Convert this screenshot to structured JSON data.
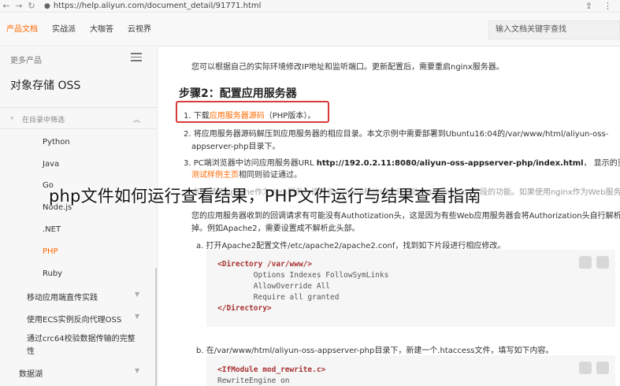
{
  "browser": {
    "url": "https://help.aliyun.com/document_detail/91771.html",
    "back_icon": "←",
    "forward_icon": "→",
    "reload_icon": "↻",
    "lock_icon": "🔒",
    "share_icon": "⇪",
    "menu_icon": "⋮"
  },
  "topnav": {
    "tabs": [
      "产品文档",
      "实战派",
      "大咖答",
      "云视界"
    ],
    "search_placeholder": "输入文档关键字查找"
  },
  "sidebar": {
    "more_products": "更多产品",
    "product_title": "对象存储 OSS",
    "filter_placeholder": "在目录中筛选",
    "filter_icon": "⌕",
    "collapse_icon": "︽",
    "sdk_items": [
      "Python",
      "Java",
      "Go",
      "Node.js",
      ".NET",
      "PHP",
      "Ruby"
    ],
    "active_item": "PHP",
    "groups": [
      "移动应用端直传实践",
      "使用ECS实例反向代理OSS",
      "通过crc64校验数据传输的完整性",
      "数据湖"
    ]
  },
  "content": {
    "intro": "您可以根据自己的实际环境修改IP地址和监听端口。更新配置后，需要重启nginx服务器。",
    "step_heading": "步骤2：配置应用服务器",
    "step1_prefix": "1. 下载",
    "step1_link": "应用服务器源码",
    "step1_suffix": "（PHP版本）。",
    "step2_line1": "2. 将应用服务器源码解压到应用服务器的相应目录。本文示例中需要部署到Ubuntu16:04的/var/www/html/aliyun-oss-",
    "step2_line2": "appserver-php目录下。",
    "step3_prefix": "3. PC端浏览器中访问应用服务器URL ",
    "step3_url": "http://192.0.2.11:8080/aliyun-oss-appserver-php/index.html",
    "step3_suffix": "，  显示的页面内容与",
    "step3_link": "测试样例主页",
    "step3_tail": "相同则验证通过。",
    "step4_line1": "4. 如果使用Apache作为Web服务，请开启Apache模块URL头部的Authorization字段的功能。如果使用nginx作为Web服务",
    "step4_line2": "您的应用服务器收到的回调请求有可能没有Authotization头，这是因为有些Web应用服务器会将Authorization头自行解析",
    "step4_line3": "掉。例如Apache2，需要设置成不解析此头部。",
    "sub_a": "a. 打开Apache2配置文件/etc/apache2/apache2.conf，找到如下片段进行相应修改。",
    "code_a": [
      "<Directory /var/www/>",
      "        Options Indexes FollowSymLinks",
      "        AllowOverride All",
      "        Require all granted",
      "</Directory>"
    ],
    "sub_b": "b. 在/var/www/html/aliyun-oss-appserver-php目录下，新建一个.htaccess文件，填写如下内容。",
    "code_b": [
      "<IfModule mod_rewrite.c>",
      "RewriteEngine on"
    ]
  },
  "overlay_title": "php文件如何运行查看结果，PHP文件运行与结果查看指南",
  "colors": {
    "accent": "#ff6a00",
    "highlight_border": "#d93a3a"
  }
}
